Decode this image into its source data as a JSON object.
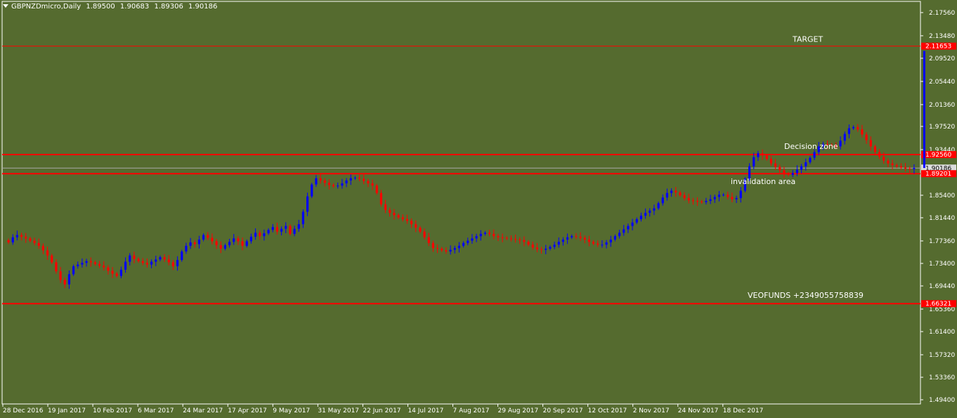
{
  "header": {
    "symbol": "GBPNZDmicro,Daily",
    "open": "1.89500",
    "high": "1.90683",
    "low": "1.89306",
    "close": "1.90186"
  },
  "colors": {
    "background": "#556b2f",
    "bull_candle": "#0000ff",
    "bear_candle": "#ff0000",
    "level_line": "#ff0000",
    "axis_text": "#ffffff"
  },
  "chart_data": {
    "type": "candlestick",
    "ylim": [
      1.4866,
      2.1953
    ],
    "y_ticks": [
      "2.17560",
      "2.13480",
      "2.09520",
      "2.05440",
      "2.01360",
      "1.97520",
      "1.93440",
      "1.85400",
      "1.81440",
      "1.77360",
      "1.73400",
      "1.69440",
      "1.65360",
      "1.61400",
      "1.57320",
      "1.53360",
      "1.49400"
    ],
    "x_ticks": [
      "28 Dec 2016",
      "19 Jan 2017",
      "10 Feb 2017",
      "6 Mar 2017",
      "24 Mar 2017",
      "17 Apr 2017",
      "9 May 2017",
      "31 May 2017",
      "22 Jun 2017",
      "14 Jul 2017",
      "7 Aug 2017",
      "29 Aug 2017",
      "20 Sep 2017",
      "12 Oct 2017",
      "2 Nov 2017",
      "24 Nov 2017",
      "18 Dec 2017"
    ],
    "grid": false,
    "current_price": {
      "value": 1.90186,
      "label": "1.90186"
    },
    "levels": [
      {
        "name": "target",
        "value": 2.11653,
        "label": "2.11653",
        "annotation": "TARGET"
      },
      {
        "name": "decision-zone",
        "value": 1.9256,
        "label": "1.92560",
        "annotation": "Decision zone"
      },
      {
        "name": "invalidation",
        "value": 1.89201,
        "label": "1.89201",
        "annotation": "invalidation area"
      },
      {
        "name": "lower",
        "value": 1.66321,
        "label": "1.66321",
        "annotation": ""
      }
    ],
    "annotations": [
      {
        "text": "VEOFUNDS      +2349055758839",
        "value": 1.678
      }
    ],
    "projection": {
      "from": 1.902,
      "to": 2.108
    },
    "closes": [
      1.771,
      1.78,
      1.784,
      1.781,
      1.778,
      1.774,
      1.77,
      1.765,
      1.757,
      1.748,
      1.736,
      1.72,
      1.705,
      1.697,
      1.715,
      1.729,
      1.732,
      1.735,
      1.738,
      1.736,
      1.733,
      1.73,
      1.727,
      1.721,
      1.716,
      1.712,
      1.723,
      1.737,
      1.748,
      1.742,
      1.738,
      1.735,
      1.732,
      1.737,
      1.741,
      1.745,
      1.741,
      1.736,
      1.729,
      1.74,
      1.755,
      1.765,
      1.771,
      1.768,
      1.776,
      1.784,
      1.779,
      1.773,
      1.766,
      1.76,
      1.766,
      1.772,
      1.778,
      1.773,
      1.765,
      1.773,
      1.781,
      1.788,
      1.782,
      1.787,
      1.793,
      1.798,
      1.79,
      1.795,
      1.8,
      1.786,
      1.795,
      1.803,
      1.825,
      1.852,
      1.873,
      1.884,
      1.88,
      1.876,
      1.872,
      1.87,
      1.871,
      1.875,
      1.88,
      1.884,
      1.885,
      1.883,
      1.879,
      1.875,
      1.871,
      1.858,
      1.838,
      1.828,
      1.823,
      1.819,
      1.815,
      1.812,
      1.809,
      1.803,
      1.797,
      1.79,
      1.78,
      1.77,
      1.761,
      1.76,
      1.757,
      1.755,
      1.758,
      1.761,
      1.765,
      1.77,
      1.774,
      1.778,
      1.782,
      1.786,
      1.788,
      1.786,
      1.782,
      1.78,
      1.779,
      1.778,
      1.777,
      1.776,
      1.775,
      1.772,
      1.767,
      1.762,
      1.759,
      1.758,
      1.76,
      1.763,
      1.767,
      1.772,
      1.776,
      1.78,
      1.782,
      1.781,
      1.779,
      1.776,
      1.772,
      1.769,
      1.767,
      1.767,
      1.771,
      1.776,
      1.782,
      1.788,
      1.794,
      1.8,
      1.806,
      1.812,
      1.818,
      1.823,
      1.827,
      1.831,
      1.84,
      1.85,
      1.858,
      1.862,
      1.859,
      1.854,
      1.849,
      1.845,
      1.844,
      1.843,
      1.842,
      1.844,
      1.847,
      1.851,
      1.855,
      1.855,
      1.851,
      1.847,
      1.849,
      1.862,
      1.883,
      1.905,
      1.921,
      1.928,
      1.924,
      1.918,
      1.91,
      1.904,
      1.898,
      1.892,
      1.89,
      1.893,
      1.899,
      1.905,
      1.912,
      1.92,
      1.93,
      1.94,
      1.944,
      1.943,
      1.942,
      1.94,
      1.95,
      1.962,
      1.972,
      1.974,
      1.97,
      1.961,
      1.951,
      1.94,
      1.93,
      1.922,
      1.915,
      1.91,
      1.907,
      1.905,
      1.903,
      1.901,
      1.9,
      1.902
    ]
  }
}
